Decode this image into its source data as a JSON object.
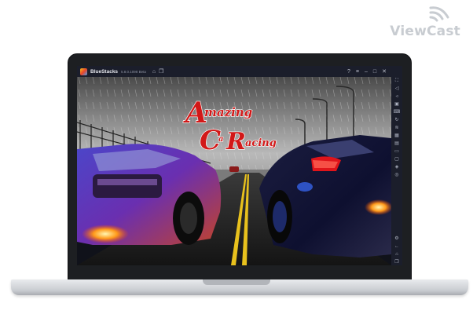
{
  "watermark": {
    "text": "ViewCast"
  },
  "window": {
    "app_name": "BlueStacks",
    "version": "5.8.0.1098 Beta"
  },
  "titlebar_icons": [
    "home-icon",
    "multi-instance-icon"
  ],
  "window_controls": [
    "help-icon",
    "menu-icon",
    "minimize-icon",
    "maximize-icon",
    "close-icon"
  ],
  "sidebar_icons": [
    "fullscreen-icon",
    "volume-up-icon",
    "volume-down-icon",
    "screen-record-icon",
    "keyboard-controls-icon",
    "rotate-icon",
    "shake-icon",
    "gamepad-icon",
    "install-apk-icon",
    "folder-icon",
    "screenshot-icon",
    "macro-icon",
    "eco-mode-icon",
    "settings-icon",
    "back-icon",
    "home-icon",
    "recent-apps-icon"
  ],
  "game": {
    "logo_line1": "mazing",
    "logo_big_a": "A",
    "logo_big_c": "C",
    "logo_small_a": "a",
    "logo_big_r": "R",
    "logo_line3": "acing"
  },
  "colors": {
    "logo_red": "#d21818",
    "titlebar_bg": "#1b1e2b",
    "road_line": "#e8c11d"
  }
}
